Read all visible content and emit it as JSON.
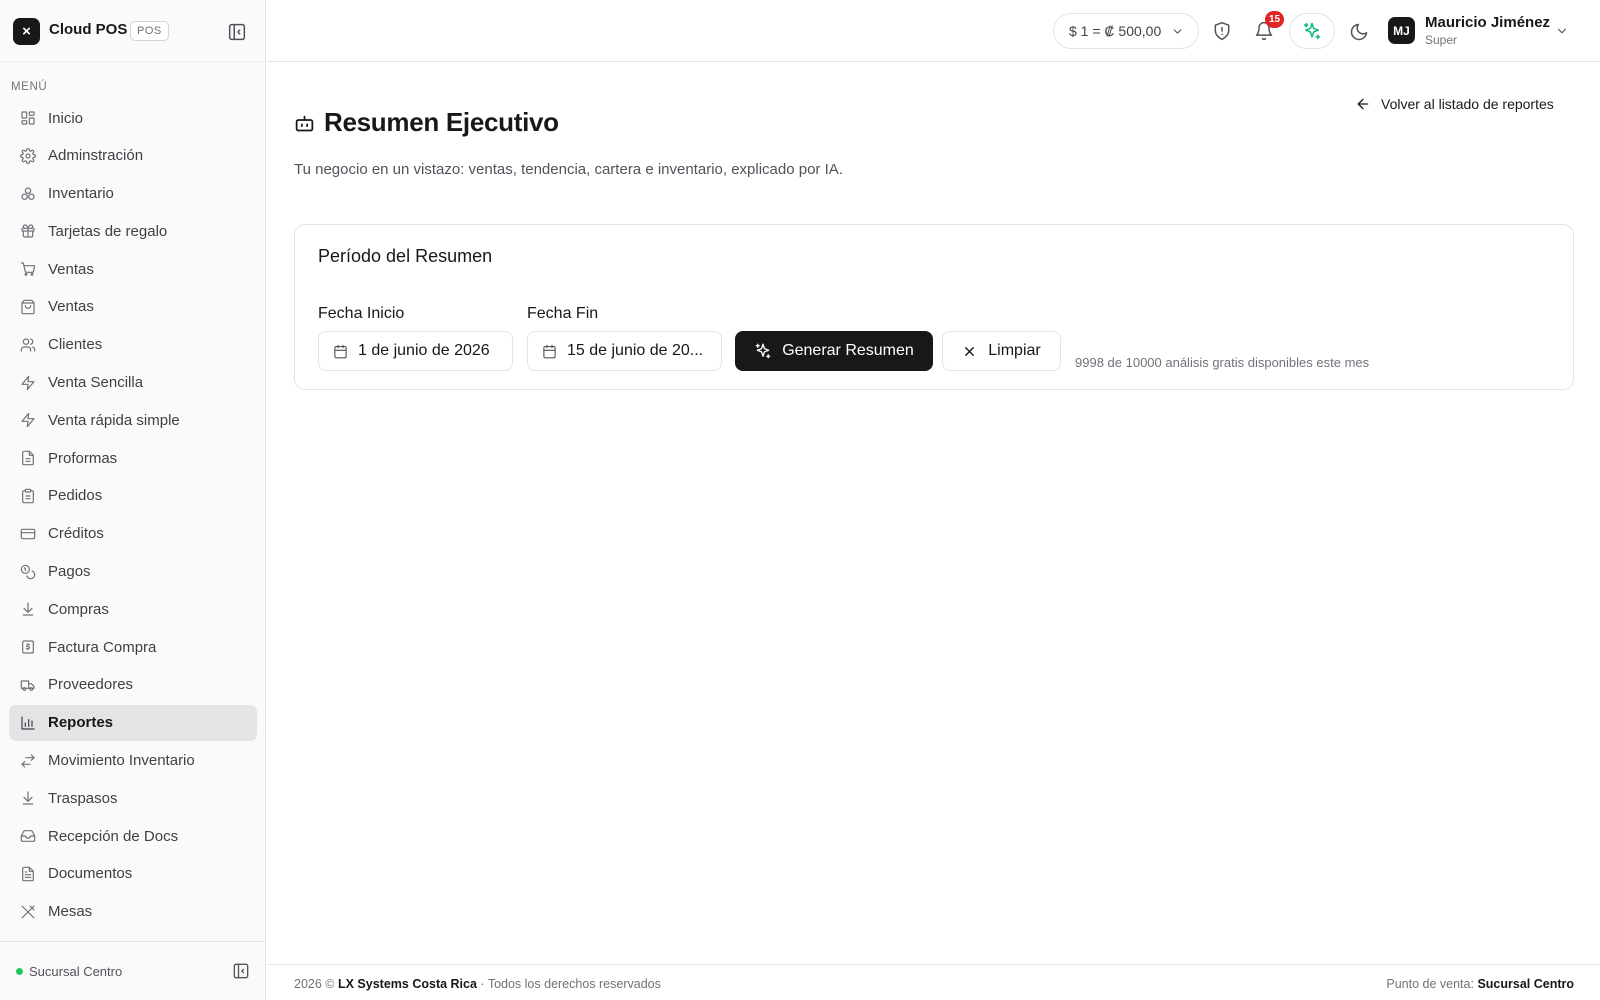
{
  "app": {
    "logo_glyph": "×",
    "name": "Cloud POS",
    "badge": "POS"
  },
  "sidebar": {
    "menu_label": "MENÚ",
    "items": [
      {
        "label": "Inicio",
        "icon": "grid-icon"
      },
      {
        "label": "Adminstración",
        "icon": "gear-icon"
      },
      {
        "label": "Inventario",
        "icon": "boxes-icon"
      },
      {
        "label": "Tarjetas de regalo",
        "icon": "gift-icon"
      },
      {
        "label": "Ventas",
        "icon": "cart-icon"
      },
      {
        "label": "Ventas",
        "icon": "shopping-bag-icon"
      },
      {
        "label": "Clientes",
        "icon": "users-icon"
      },
      {
        "label": "Venta Sencilla",
        "icon": "lightning-icon"
      },
      {
        "label": "Venta rápida simple",
        "icon": "lightning-icon"
      },
      {
        "label": "Proformas",
        "icon": "file-icon"
      },
      {
        "label": "Pedidos",
        "icon": "clipboard-icon"
      },
      {
        "label": "Créditos",
        "icon": "credit-card-icon"
      },
      {
        "label": "Pagos",
        "icon": "coins-icon"
      },
      {
        "label": "Compras",
        "icon": "download-icon"
      },
      {
        "label": "Factura Compra",
        "icon": "receipt-icon"
      },
      {
        "label": "Proveedores",
        "icon": "truck-icon"
      },
      {
        "label": "Reportes",
        "icon": "bar-chart-icon",
        "active": true
      },
      {
        "label": "Movimiento Inventario",
        "icon": "arrows-exchange-icon"
      },
      {
        "label": "Traspasos",
        "icon": "download-icon"
      },
      {
        "label": "Recepción de Docs",
        "icon": "inbox-icon"
      },
      {
        "label": "Documentos",
        "icon": "document-icon"
      },
      {
        "label": "Mesas",
        "icon": "utensils-icon"
      }
    ],
    "branch": "Sucursal Centro"
  },
  "topbar": {
    "exchange_rate": "$ 1 =  ₡ 500,00",
    "notifications_count": "15",
    "user": {
      "initials": "MJ",
      "name": "Mauricio Jiménez",
      "role": "Super"
    }
  },
  "main": {
    "back_link": "Volver al listado de reportes",
    "title": "Resumen Ejecutivo",
    "subtitle": "Tu negocio en un vistazo: ventas, tendencia, cartera e inventario, explicado por IA.",
    "card": {
      "title": "Período del Resumen",
      "start_label": "Fecha Inicio",
      "start_value": "1 de junio de 2026",
      "end_label": "Fecha Fin",
      "end_value": "15 de junio de 20...",
      "generate_label": "Generar Resumen",
      "clear_label": "Limpiar",
      "quota_text": "9998 de 10000 análisis gratis disponibles este mes"
    }
  },
  "footer": {
    "year": "2026 ©",
    "company": "LX Systems Costa Rica",
    "rights": "· Todos los derechos reservados",
    "pos_label": "Punto de venta:",
    "pos_value": "Sucursal Centro"
  },
  "colors": {
    "accent": "#18181b",
    "active_bg": "#e4e4e7",
    "notification": "#dc2626",
    "ai": "#10b981",
    "status_online": "#22c55e"
  }
}
